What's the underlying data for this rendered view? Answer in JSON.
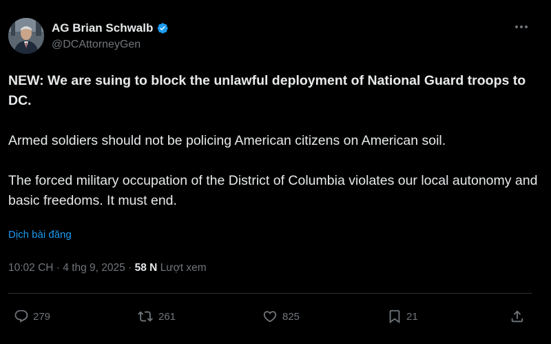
{
  "author": {
    "display_name": "AG Brian Schwalb",
    "handle": "@DCAttorneyGen",
    "avatar_icon": "profile-photo",
    "verified_icon": "verified-badge-icon",
    "verified_color": "#1d9bf0"
  },
  "more_icon": "more-options-icon",
  "post": {
    "paragraphs": [
      "NEW: We are suing to block the unlawful deployment of National Guard troops to DC.",
      "Armed soldiers should not be policing American citizens on American soil.",
      "The forced military occupation of the District of Columbia violates our local autonomy and basic freedoms. It must end."
    ]
  },
  "translate_label": "Dịch bài đăng",
  "meta": {
    "time": "10:02 CH",
    "separator": "·",
    "date": "4 thg 9, 2025",
    "views_count": "58 N",
    "views_label": "Lượt xem"
  },
  "actions": {
    "reply": {
      "icon": "reply-icon",
      "count": "279"
    },
    "repost": {
      "icon": "repost-icon",
      "count": "261"
    },
    "like": {
      "icon": "heart-icon",
      "count": "825"
    },
    "bookmark": {
      "icon": "bookmark-icon",
      "count": "21"
    },
    "share": {
      "icon": "share-icon"
    }
  },
  "colors": {
    "background": "#000000",
    "text": "#e7e9ea",
    "muted": "#71767b",
    "link": "#1d9bf0",
    "divider": "#2f3336"
  }
}
